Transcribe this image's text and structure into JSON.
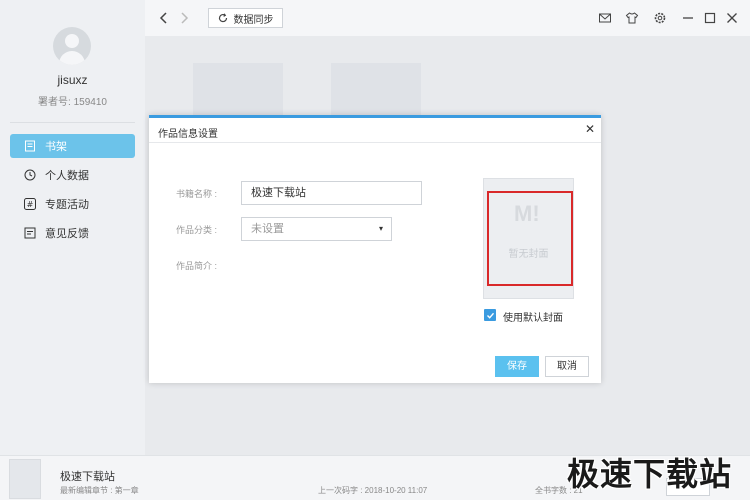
{
  "toolbar": {
    "sync_label": "数据同步",
    "icons": [
      "back-arrow-icon",
      "forward-arrow-icon",
      "sync-icon",
      "mail-icon",
      "shirt-icon",
      "gear-icon",
      "minimize-icon",
      "maximize-icon",
      "close-icon"
    ]
  },
  "sidebar": {
    "username": "jisuxz",
    "uid": "署者号: 159410",
    "items": [
      {
        "label": "书架",
        "icon": "bookshelf-icon",
        "active": true
      },
      {
        "label": "个人数据",
        "icon": "clock-icon",
        "active": false
      },
      {
        "label": "专题活动",
        "icon": "hash-icon",
        "active": false
      },
      {
        "label": "意见反馈",
        "icon": "feedback-icon",
        "active": false
      }
    ]
  },
  "dialog": {
    "title": "作品信息设置",
    "close": "✕",
    "book_name_label": "书籍名称 :",
    "book_name_value": "极速下载站",
    "category_label": "作品分类 :",
    "category_value": "未设置",
    "intro_label": "作品简介 :",
    "cover_placeholder": "暂无封面",
    "cover_logo": "M!",
    "use_default_cover": "使用默认封面",
    "save": "保存",
    "cancel": "取消"
  },
  "statusbar": {
    "book_title": "极速下载站",
    "latest_chapter": "最新编辑章节 : 第一章",
    "last_sync": "上一次码字 : 2018-10-20 11:07",
    "total_words": "全书字数 : 21"
  },
  "watermark": "极速下载站",
  "colors": {
    "accent": "#3a9be0",
    "active_nav": "#6cc3ea",
    "save_button": "#5bc1ef",
    "highlight_box": "#d9292a"
  }
}
